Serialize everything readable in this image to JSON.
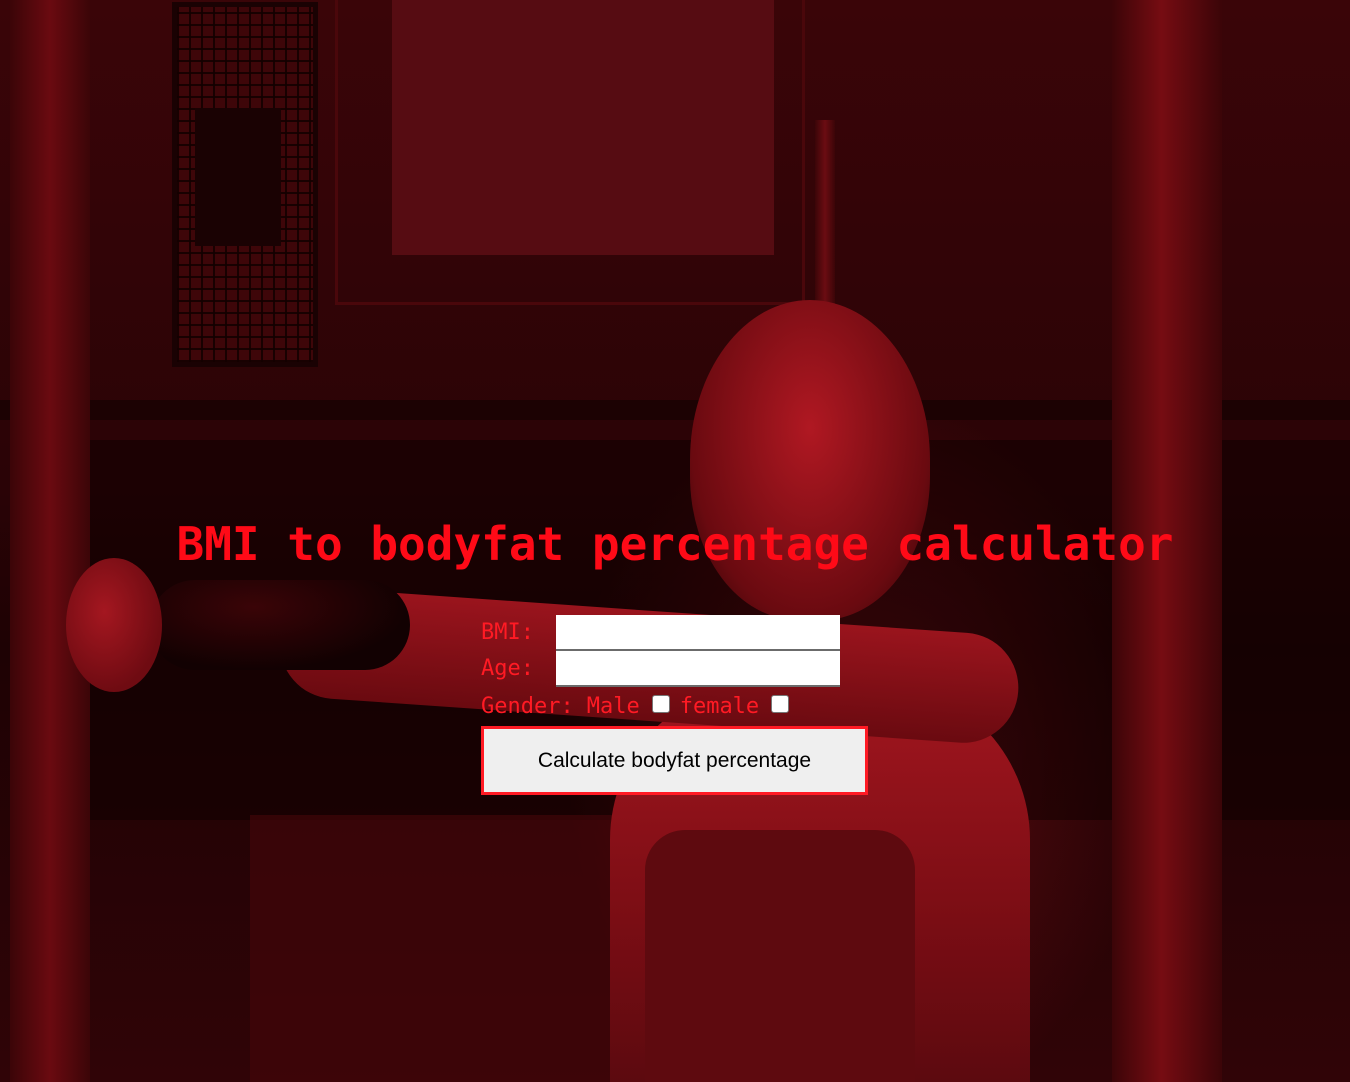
{
  "page": {
    "title": "BMI to bodyfat percentage calculator",
    "accent_color": "#ff0a17"
  },
  "form": {
    "bmi_label": "BMI:",
    "bmi_value": "",
    "age_label": "Age:",
    "age_value": "",
    "gender_label": "Gender:",
    "male_label": "Male",
    "male_checked": false,
    "female_label": "female",
    "female_checked": false,
    "submit_label": "Calculate bodyfat percentage"
  },
  "background": {
    "description_icon": "gym-photo-background",
    "tint_color": "#a0141c"
  }
}
